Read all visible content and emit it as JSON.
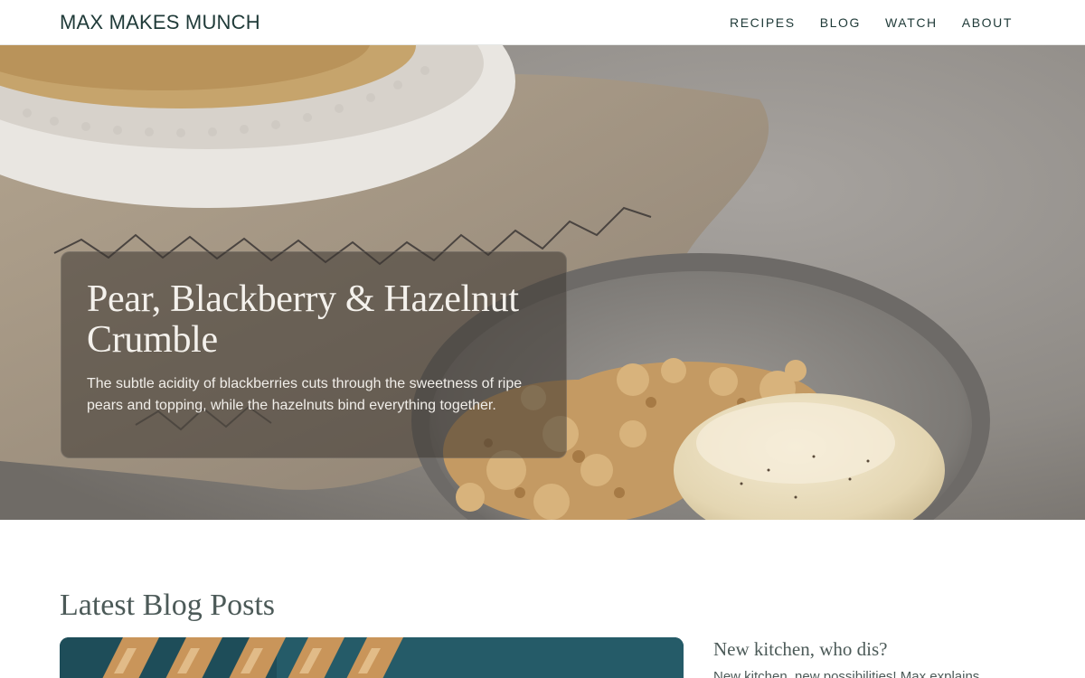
{
  "header": {
    "brand": "MAX MAKES MUNCH",
    "nav": [
      {
        "label": "RECIPES"
      },
      {
        "label": "BLOG"
      },
      {
        "label": "WATCH"
      },
      {
        "label": "ABOUT"
      }
    ]
  },
  "hero": {
    "title": "Pear, Blackberry & Hazelnut Crumble",
    "description": "The subtle acidity of blackberries cuts through the sweetness of ripe pears and topping, while the hazelnuts bind everything together."
  },
  "blog": {
    "section_title": "Latest Blog Posts",
    "side_post": {
      "title": "New kitchen, who dis?",
      "excerpt": "New kitchen, new possibilities! Max explains"
    }
  },
  "colors": {
    "brand_text": "#1f3a38",
    "muted_heading": "#4c5a58"
  }
}
